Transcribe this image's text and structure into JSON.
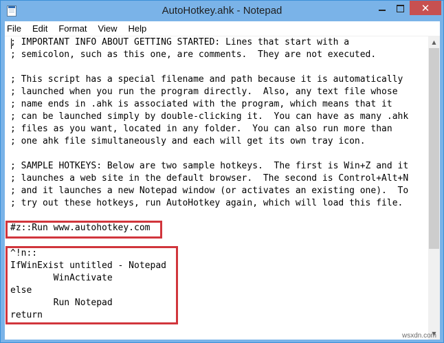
{
  "window": {
    "title": "AutoHotkey.ahk - Notepad",
    "icon": "notepad-icon",
    "buttons": {
      "minimize": "minimize-icon",
      "maximize": "maximize-icon",
      "close": "close-icon",
      "close_glyph": "✕"
    }
  },
  "menu": [
    "File",
    "Edit",
    "Format",
    "View",
    "Help"
  ],
  "editor": {
    "lines": [
      "; IMPORTANT INFO ABOUT GETTING STARTED: Lines that start with a",
      "; semicolon, such as this one, are comments.  They are not executed.",
      "",
      "; This script has a special filename and path because it is automatically",
      "; launched when you run the program directly.  Also, any text file whose",
      "; name ends in .ahk is associated with the program, which means that it",
      "; can be launched simply by double-clicking it.  You can have as many .ahk",
      "; files as you want, located in any folder.  You can also run more than",
      "; one ahk file simultaneously and each will get its own tray icon.",
      "",
      "; SAMPLE HOTKEYS: Below are two sample hotkeys.  The first is Win+Z and it",
      "; launches a web site in the default browser.  The second is Control+Alt+N",
      "; and it launches a new Notepad window (or activates an existing one).  To",
      "; try out these hotkeys, run AutoHotkey again, which will load this file.",
      "",
      "#z::Run www.autohotkey.com",
      "",
      "^!n::",
      "IfWinExist untitled - Notepad",
      "        WinActivate",
      "else",
      "        Run Notepad",
      "return"
    ],
    "highlight_color": "#d1353c"
  },
  "watermark": "wsxdn.com",
  "colors": {
    "titlebar": "#7ab3e8",
    "close_button": "#c75050"
  }
}
